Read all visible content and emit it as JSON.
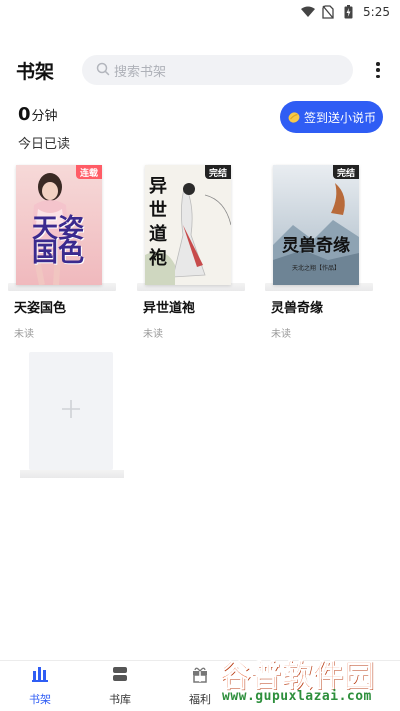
{
  "status_bar": {
    "time": "5:25",
    "icons": [
      "wifi-icon",
      "no-sim-icon",
      "battery-charging-icon"
    ]
  },
  "header": {
    "title": "书架",
    "search_placeholder": "搜索书架",
    "more_icon": "more-vertical-icon"
  },
  "reading": {
    "minutes": "0",
    "unit": "分钟",
    "label": "今日已读"
  },
  "signin_button": {
    "label": "签到送小说币",
    "icon": "coin-icon"
  },
  "books": [
    {
      "title": "天姿国色",
      "status": "未读",
      "tag": "连载",
      "cover_text": "天姿国色"
    },
    {
      "title": "异世道袍",
      "status": "未读",
      "tag": "完结",
      "cover_text": "异世道袍"
    },
    {
      "title": "灵兽奇缘",
      "status": "未读",
      "tag": "完结",
      "cover_text": "灵兽奇缘",
      "cover_subtext": "天北之翔【作品】"
    }
  ],
  "add_book": {
    "icon": "plus-icon"
  },
  "bottom_nav": [
    {
      "label": "书架",
      "icon": "bookshelf-icon",
      "active": true
    },
    {
      "label": "书库",
      "icon": "library-icon",
      "active": false
    },
    {
      "label": "福利",
      "icon": "gift-icon",
      "active": false
    }
  ],
  "watermark": {
    "logo": "谷普软件园",
    "url": "www.gupuxlazai.com"
  },
  "colors": {
    "accent": "#2f5df4",
    "serial_tag": "#ff5c66",
    "done_tag": "#222222",
    "search_bg": "#f1f2f5"
  }
}
